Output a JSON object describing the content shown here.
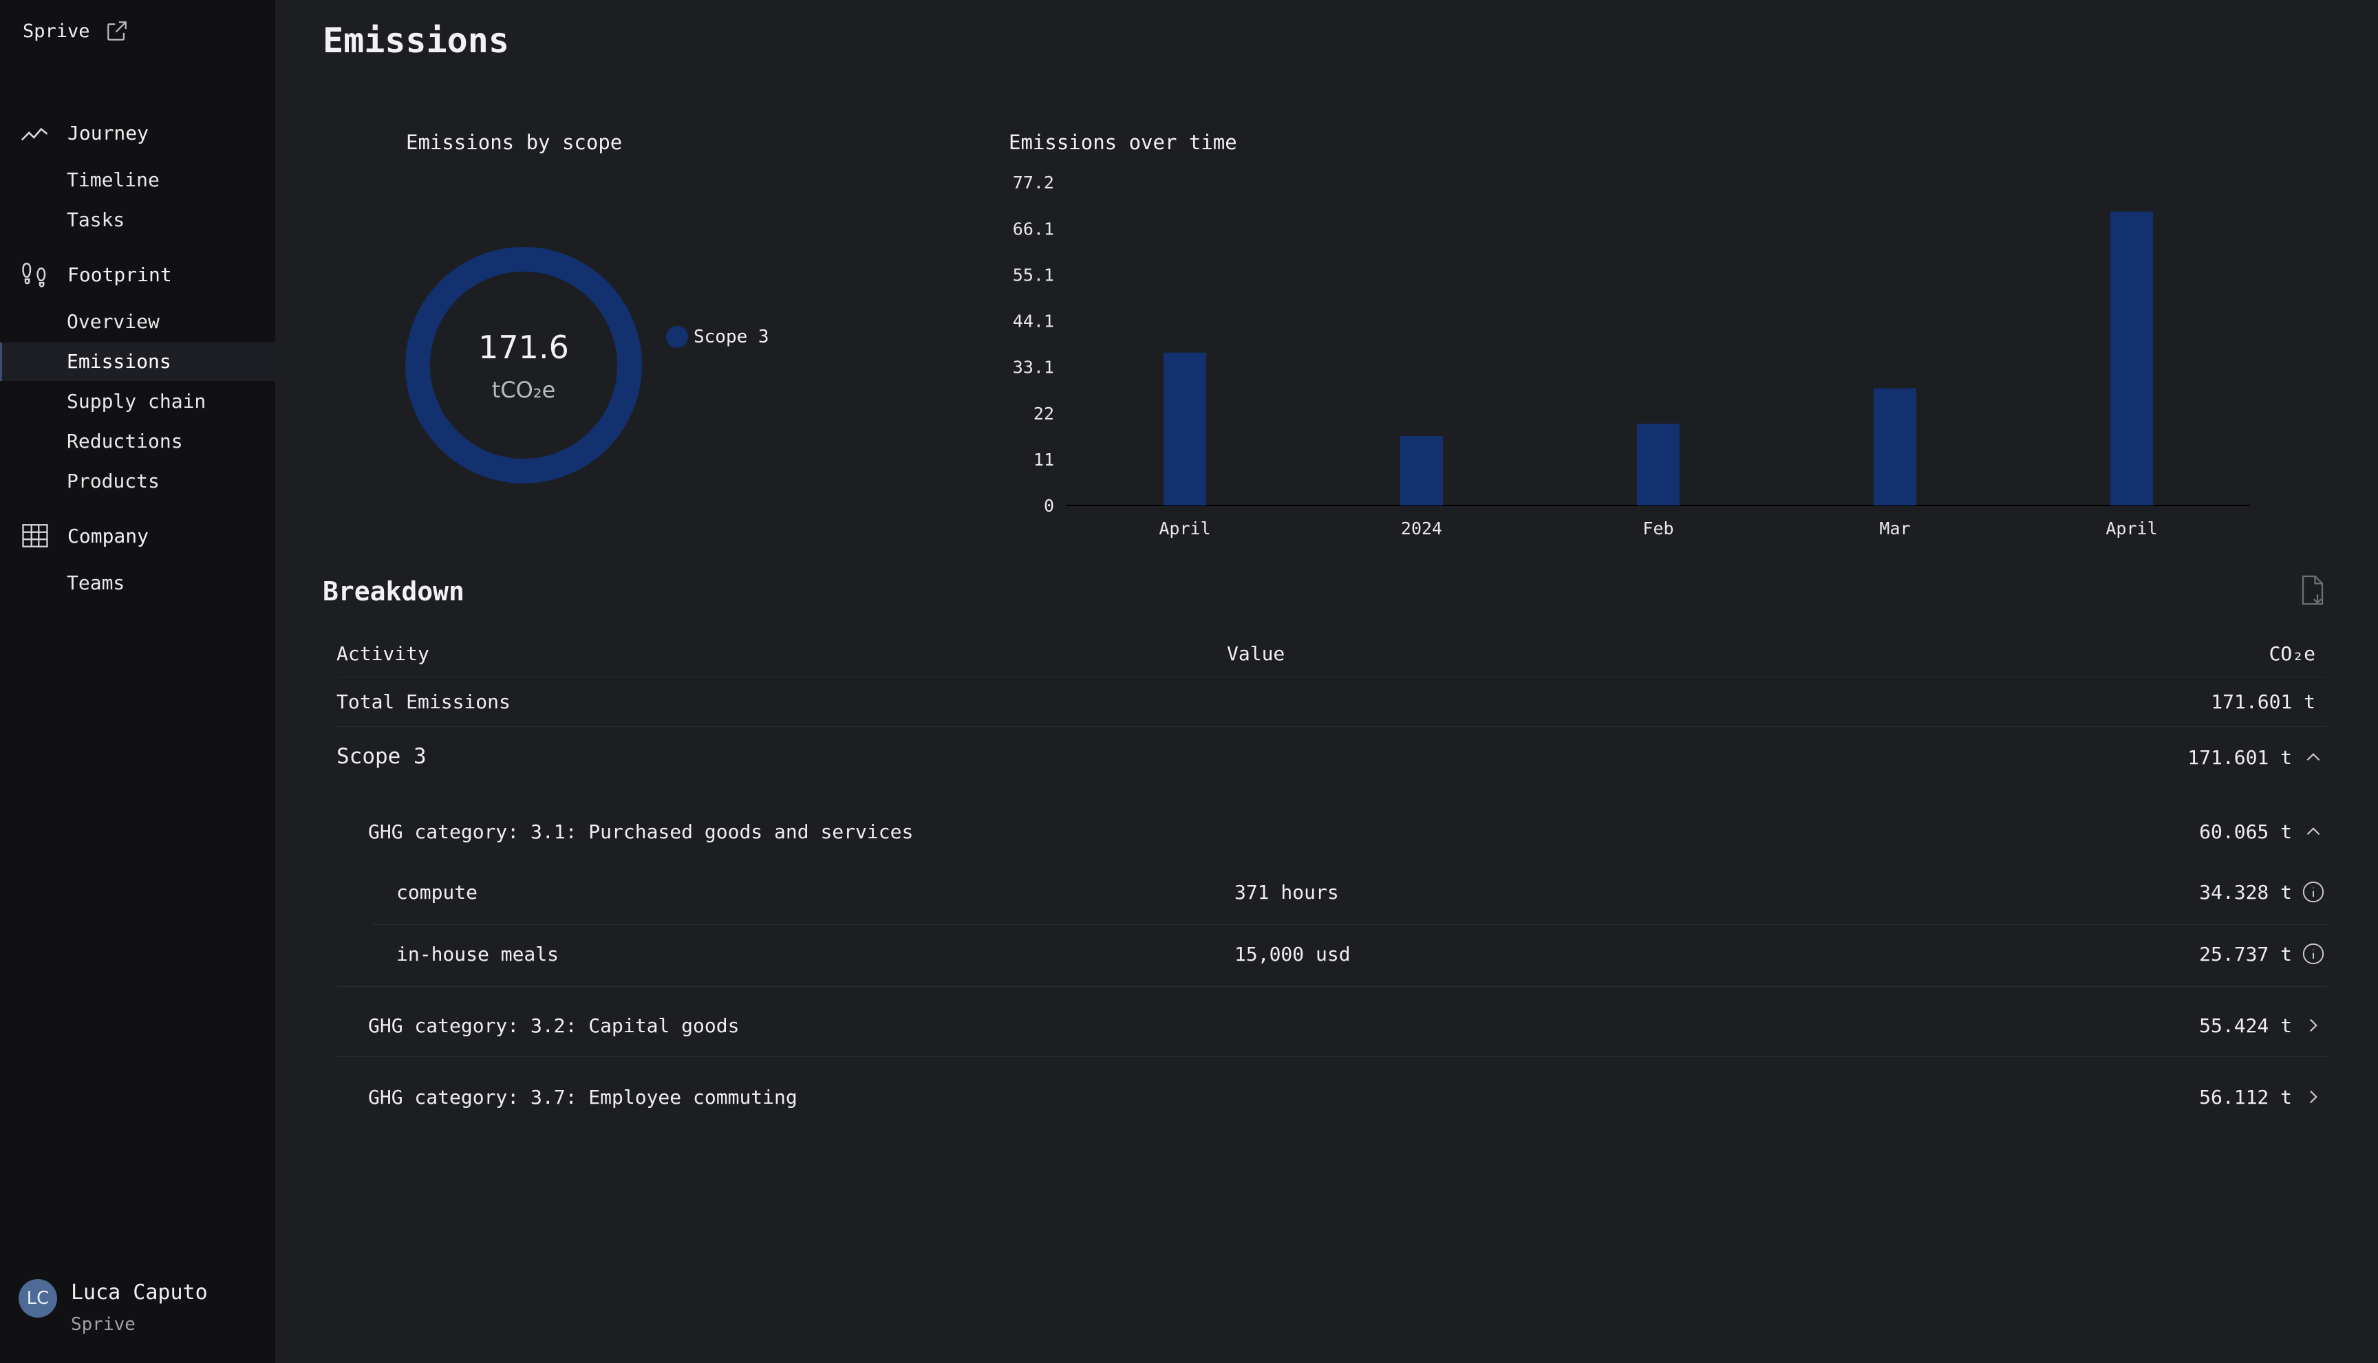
{
  "app": {
    "brand": "Sprive",
    "page_title": "Emissions"
  },
  "sidebar": {
    "groups": [
      {
        "label": "Journey",
        "icon": "trend-line-icon",
        "items": [
          "Timeline",
          "Tasks"
        ]
      },
      {
        "label": "Footprint",
        "icon": "footprints-icon",
        "items": [
          "Overview",
          "Emissions",
          "Supply chain",
          "Reductions",
          "Products"
        ]
      },
      {
        "label": "Company",
        "icon": "building-icon",
        "items": [
          "Teams"
        ]
      }
    ],
    "active_item": "Emissions"
  },
  "user": {
    "initials": "LC",
    "name": "Luca Caputo",
    "org": "Sprive"
  },
  "scope_chart": {
    "title": "Emissions by scope",
    "total": "171.6",
    "unit": "tCO₂e",
    "legend": "Scope 3",
    "color": "#13306f"
  },
  "chart_data": [
    {
      "type": "pie",
      "title": "Emissions by scope",
      "categories": [
        "Scope 3"
      ],
      "values": [
        171.6
      ],
      "legend": "right"
    },
    {
      "type": "bar",
      "title": "Emissions over time",
      "categories": [
        "April",
        "2024",
        "Feb",
        "Mar",
        "April"
      ],
      "values": [
        36.5,
        16.6,
        19.5,
        28.0,
        70.2
      ],
      "yticks": [
        "0",
        "11",
        "22",
        "33.1",
        "44.1",
        "55.1",
        "66.1",
        "77.2"
      ],
      "ylim": [
        0,
        77.2
      ],
      "grid": false,
      "color": "#13306f"
    }
  ],
  "breakdown": {
    "title": "Breakdown",
    "columns": {
      "activity": "Activity",
      "value": "Value",
      "co2e": "CO₂e"
    },
    "total": {
      "label": "Total Emissions",
      "co2e": "171.601 t"
    },
    "scope3": {
      "label": "Scope 3",
      "co2e": "171.601 t"
    },
    "categories": [
      {
        "label": "GHG category: 3.1: Purchased goods and services",
        "co2e": "60.065 t",
        "expanded": true,
        "rows": [
          {
            "activity": "compute",
            "value": "371 hours",
            "co2e": "34.328 t"
          },
          {
            "activity": "in-house meals",
            "value": "15,000 usd",
            "co2e": "25.737 t"
          }
        ]
      },
      {
        "label": "GHG category: 3.2: Capital goods",
        "co2e": "55.424 t",
        "expanded": false
      },
      {
        "label": "GHG category: 3.7: Employee commuting",
        "co2e": "56.112 t",
        "expanded": false
      }
    ]
  }
}
